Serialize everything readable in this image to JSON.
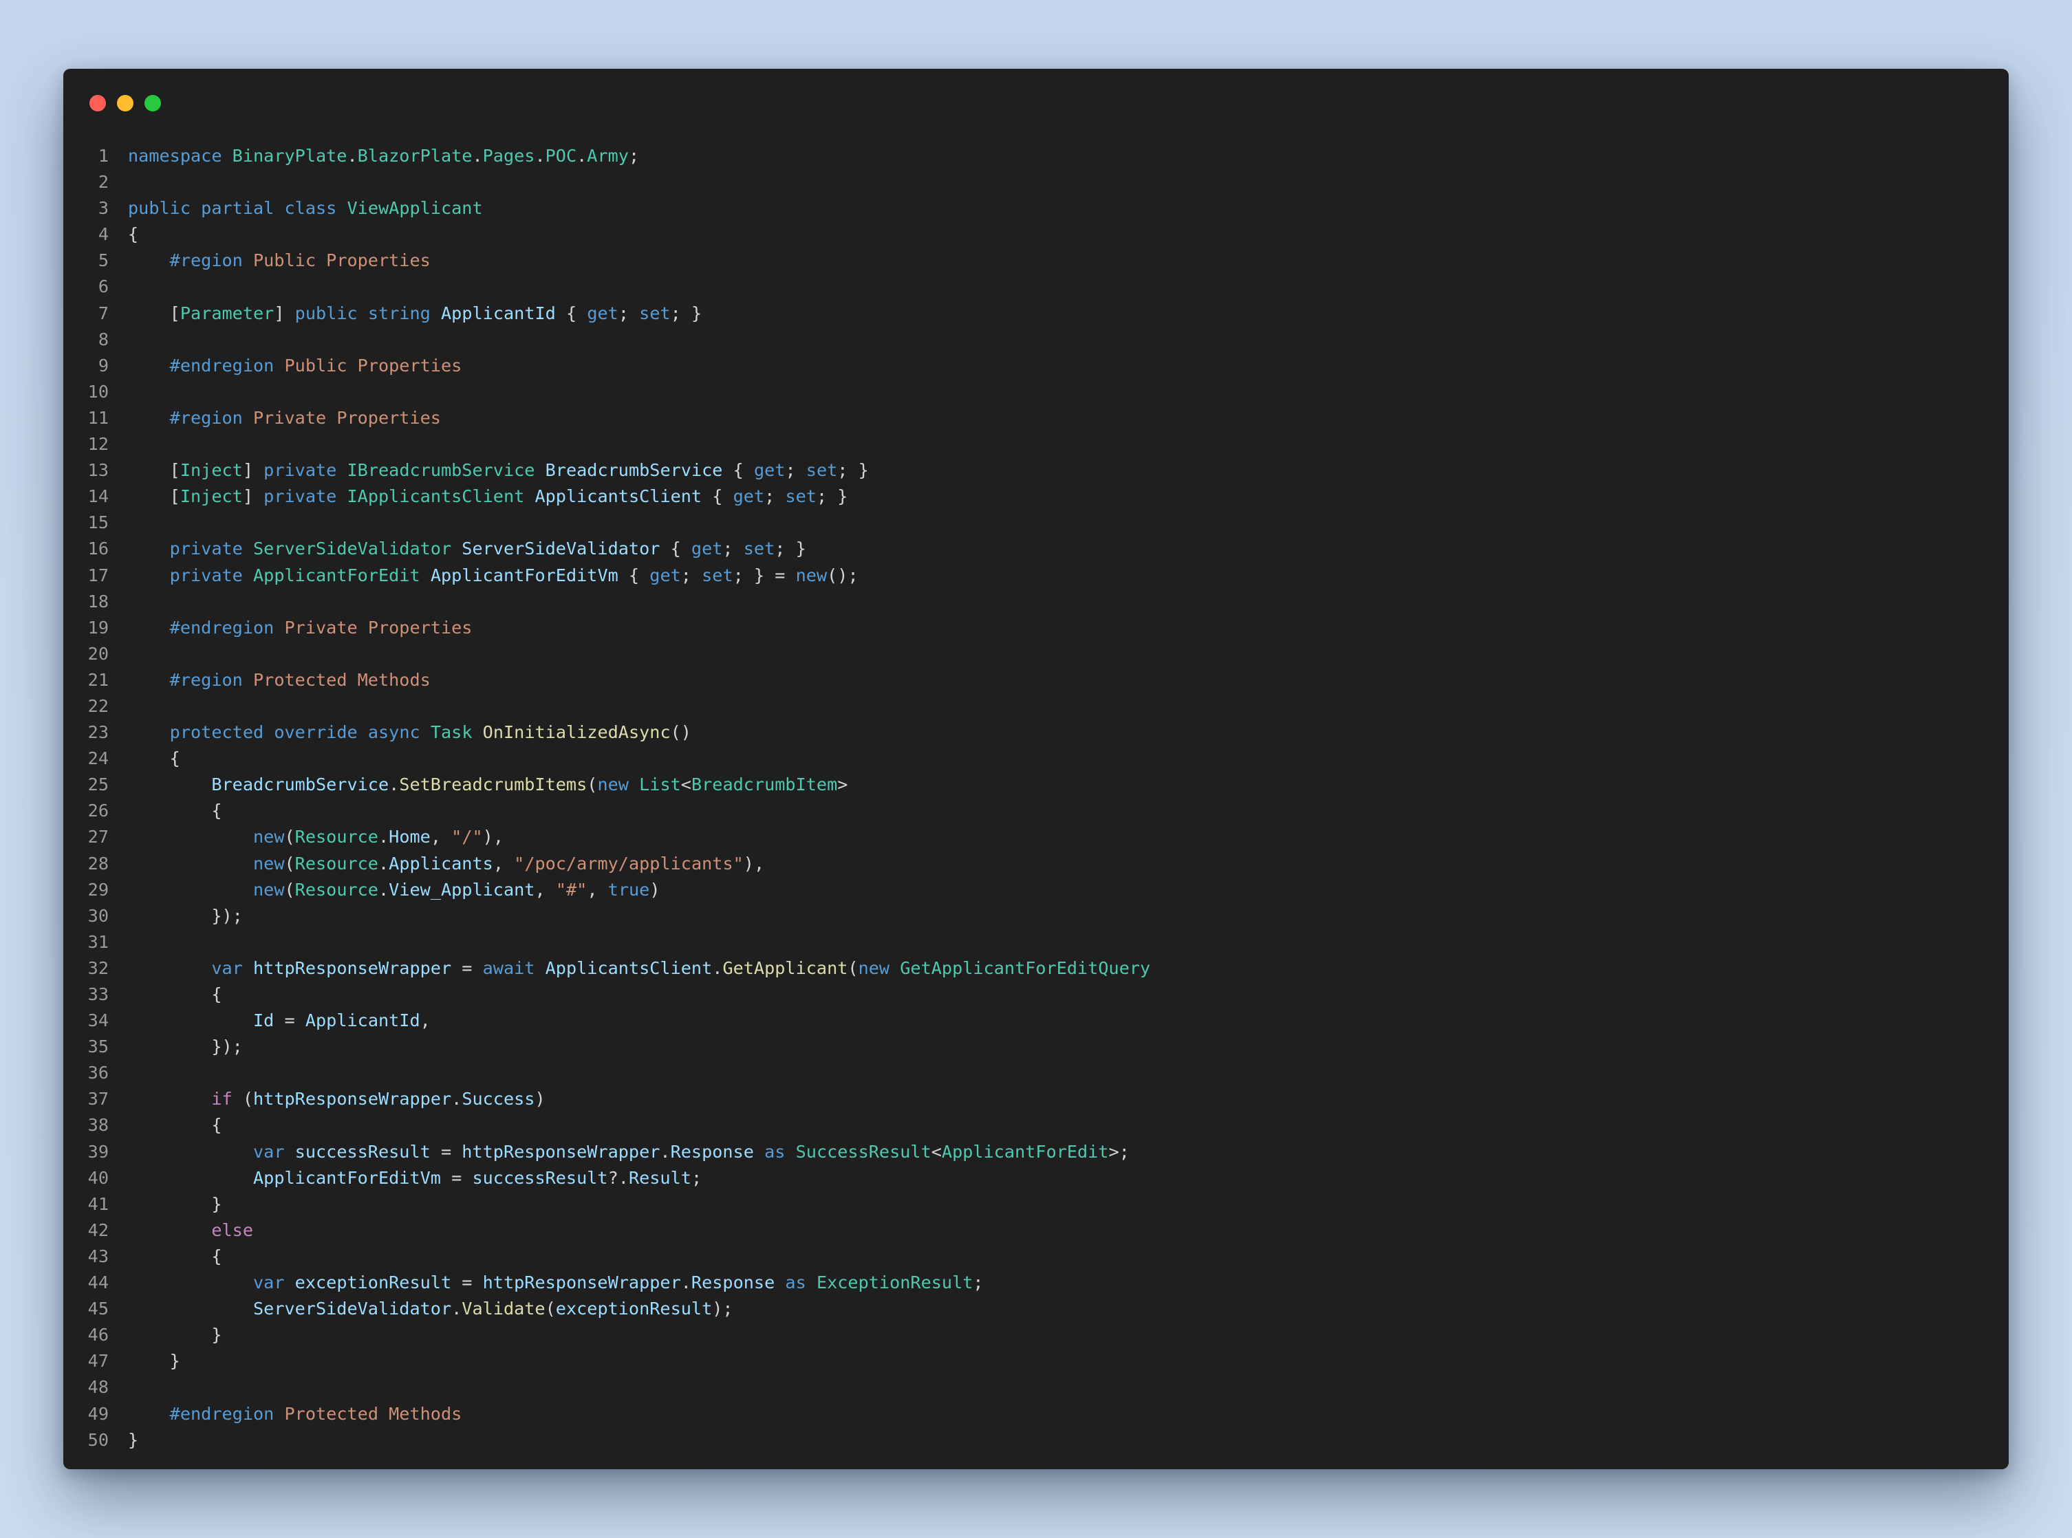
{
  "window": {
    "controls": [
      "close",
      "minimize",
      "maximize"
    ],
    "colors": {
      "close": "#ff5f57",
      "minimize": "#febc2e",
      "maximize": "#28c840",
      "background": "#1f1f1f"
    }
  },
  "editor": {
    "language": "csharp",
    "lines": [
      [
        [
          "kw",
          "namespace"
        ],
        [
          "p",
          " "
        ],
        [
          "type",
          "BinaryPlate"
        ],
        [
          "p",
          "."
        ],
        [
          "type",
          "BlazorPlate"
        ],
        [
          "p",
          "."
        ],
        [
          "type",
          "Pages"
        ],
        [
          "p",
          "."
        ],
        [
          "type",
          "POC"
        ],
        [
          "p",
          "."
        ],
        [
          "type",
          "Army"
        ],
        [
          "p",
          ";"
        ]
      ],
      [],
      [
        [
          "kw",
          "public"
        ],
        [
          "p",
          " "
        ],
        [
          "kw",
          "partial"
        ],
        [
          "p",
          " "
        ],
        [
          "kw",
          "class"
        ],
        [
          "p",
          " "
        ],
        [
          "type",
          "ViewApplicant"
        ]
      ],
      [
        [
          "p",
          "{"
        ]
      ],
      [
        [
          "p",
          "    "
        ],
        [
          "kw",
          "#region"
        ],
        [
          "p",
          " "
        ],
        [
          "reg",
          "Public Properties"
        ]
      ],
      [],
      [
        [
          "p",
          "    ["
        ],
        [
          "type",
          "Parameter"
        ],
        [
          "p",
          "] "
        ],
        [
          "kw",
          "public"
        ],
        [
          "p",
          " "
        ],
        [
          "kw",
          "string"
        ],
        [
          "p",
          " "
        ],
        [
          "id",
          "ApplicantId"
        ],
        [
          "p",
          " { "
        ],
        [
          "kw",
          "get"
        ],
        [
          "p",
          "; "
        ],
        [
          "kw",
          "set"
        ],
        [
          "p",
          "; }"
        ]
      ],
      [],
      [
        [
          "p",
          "    "
        ],
        [
          "kw",
          "#endregion"
        ],
        [
          "p",
          " "
        ],
        [
          "reg",
          "Public Properties"
        ]
      ],
      [],
      [
        [
          "p",
          "    "
        ],
        [
          "kw",
          "#region"
        ],
        [
          "p",
          " "
        ],
        [
          "reg",
          "Private Properties"
        ]
      ],
      [],
      [
        [
          "p",
          "    ["
        ],
        [
          "type",
          "Inject"
        ],
        [
          "p",
          "] "
        ],
        [
          "kw",
          "private"
        ],
        [
          "p",
          " "
        ],
        [
          "type",
          "IBreadcrumbService"
        ],
        [
          "p",
          " "
        ],
        [
          "id",
          "BreadcrumbService"
        ],
        [
          "p",
          " { "
        ],
        [
          "kw",
          "get"
        ],
        [
          "p",
          "; "
        ],
        [
          "kw",
          "set"
        ],
        [
          "p",
          "; }"
        ]
      ],
      [
        [
          "p",
          "    ["
        ],
        [
          "type",
          "Inject"
        ],
        [
          "p",
          "] "
        ],
        [
          "kw",
          "private"
        ],
        [
          "p",
          " "
        ],
        [
          "type",
          "IApplicantsClient"
        ],
        [
          "p",
          " "
        ],
        [
          "id",
          "ApplicantsClient"
        ],
        [
          "p",
          " { "
        ],
        [
          "kw",
          "get"
        ],
        [
          "p",
          "; "
        ],
        [
          "kw",
          "set"
        ],
        [
          "p",
          "; }"
        ]
      ],
      [],
      [
        [
          "p",
          "    "
        ],
        [
          "kw",
          "private"
        ],
        [
          "p",
          " "
        ],
        [
          "type",
          "ServerSideValidator"
        ],
        [
          "p",
          " "
        ],
        [
          "id",
          "ServerSideValidator"
        ],
        [
          "p",
          " { "
        ],
        [
          "kw",
          "get"
        ],
        [
          "p",
          "; "
        ],
        [
          "kw",
          "set"
        ],
        [
          "p",
          "; }"
        ]
      ],
      [
        [
          "p",
          "    "
        ],
        [
          "kw",
          "private"
        ],
        [
          "p",
          " "
        ],
        [
          "type",
          "ApplicantForEdit"
        ],
        [
          "p",
          " "
        ],
        [
          "id",
          "ApplicantForEditVm"
        ],
        [
          "p",
          " { "
        ],
        [
          "kw",
          "get"
        ],
        [
          "p",
          "; "
        ],
        [
          "kw",
          "set"
        ],
        [
          "p",
          "; } = "
        ],
        [
          "kw",
          "new"
        ],
        [
          "p",
          "();"
        ]
      ],
      [],
      [
        [
          "p",
          "    "
        ],
        [
          "kw",
          "#endregion"
        ],
        [
          "p",
          " "
        ],
        [
          "reg",
          "Private Properties"
        ]
      ],
      [],
      [
        [
          "p",
          "    "
        ],
        [
          "kw",
          "#region"
        ],
        [
          "p",
          " "
        ],
        [
          "reg",
          "Protected Methods"
        ]
      ],
      [],
      [
        [
          "p",
          "    "
        ],
        [
          "kw",
          "protected"
        ],
        [
          "p",
          " "
        ],
        [
          "kw",
          "override"
        ],
        [
          "p",
          " "
        ],
        [
          "kw",
          "async"
        ],
        [
          "p",
          " "
        ],
        [
          "type",
          "Task"
        ],
        [
          "p",
          " "
        ],
        [
          "fn",
          "OnInitializedAsync"
        ],
        [
          "p",
          "()"
        ]
      ],
      [
        [
          "p",
          "    {"
        ]
      ],
      [
        [
          "p",
          "        "
        ],
        [
          "id",
          "BreadcrumbService"
        ],
        [
          "p",
          "."
        ],
        [
          "fn",
          "SetBreadcrumbItems"
        ],
        [
          "p",
          "("
        ],
        [
          "kw",
          "new"
        ],
        [
          "p",
          " "
        ],
        [
          "type",
          "List"
        ],
        [
          "p",
          "<"
        ],
        [
          "type",
          "BreadcrumbItem"
        ],
        [
          "p",
          ">"
        ]
      ],
      [
        [
          "p",
          "        {"
        ]
      ],
      [
        [
          "p",
          "            "
        ],
        [
          "kw",
          "new"
        ],
        [
          "p",
          "("
        ],
        [
          "type",
          "Resource"
        ],
        [
          "p",
          "."
        ],
        [
          "id",
          "Home"
        ],
        [
          "p",
          ", "
        ],
        [
          "str",
          "\"/\""
        ],
        [
          "p",
          "),"
        ]
      ],
      [
        [
          "p",
          "            "
        ],
        [
          "kw",
          "new"
        ],
        [
          "p",
          "("
        ],
        [
          "type",
          "Resource"
        ],
        [
          "p",
          "."
        ],
        [
          "id",
          "Applicants"
        ],
        [
          "p",
          ", "
        ],
        [
          "str",
          "\"/poc/army/applicants\""
        ],
        [
          "p",
          "),"
        ]
      ],
      [
        [
          "p",
          "            "
        ],
        [
          "kw",
          "new"
        ],
        [
          "p",
          "("
        ],
        [
          "type",
          "Resource"
        ],
        [
          "p",
          "."
        ],
        [
          "id",
          "View_Applicant"
        ],
        [
          "p",
          ", "
        ],
        [
          "str",
          "\"#\""
        ],
        [
          "p",
          ", "
        ],
        [
          "kw",
          "true"
        ],
        [
          "p",
          ")"
        ]
      ],
      [
        [
          "p",
          "        });"
        ]
      ],
      [],
      [
        [
          "p",
          "        "
        ],
        [
          "kw",
          "var"
        ],
        [
          "p",
          " "
        ],
        [
          "id",
          "httpResponseWrapper"
        ],
        [
          "p",
          " = "
        ],
        [
          "kw",
          "await"
        ],
        [
          "p",
          " "
        ],
        [
          "id",
          "ApplicantsClient"
        ],
        [
          "p",
          "."
        ],
        [
          "fn",
          "GetApplicant"
        ],
        [
          "p",
          "("
        ],
        [
          "kw",
          "new"
        ],
        [
          "p",
          " "
        ],
        [
          "type",
          "GetApplicantForEditQuery"
        ]
      ],
      [
        [
          "p",
          "        {"
        ]
      ],
      [
        [
          "p",
          "            "
        ],
        [
          "id",
          "Id"
        ],
        [
          "p",
          " = "
        ],
        [
          "id",
          "ApplicantId"
        ],
        [
          "p",
          ","
        ]
      ],
      [
        [
          "p",
          "        });"
        ]
      ],
      [],
      [
        [
          "p",
          "        "
        ],
        [
          "ctrl",
          "if"
        ],
        [
          "p",
          " ("
        ],
        [
          "id",
          "httpResponseWrapper"
        ],
        [
          "p",
          "."
        ],
        [
          "id",
          "Success"
        ],
        [
          "p",
          ")"
        ]
      ],
      [
        [
          "p",
          "        {"
        ]
      ],
      [
        [
          "p",
          "            "
        ],
        [
          "kw",
          "var"
        ],
        [
          "p",
          " "
        ],
        [
          "id",
          "successResult"
        ],
        [
          "p",
          " = "
        ],
        [
          "id",
          "httpResponseWrapper"
        ],
        [
          "p",
          "."
        ],
        [
          "id",
          "Response"
        ],
        [
          "p",
          " "
        ],
        [
          "kw",
          "as"
        ],
        [
          "p",
          " "
        ],
        [
          "type",
          "SuccessResult"
        ],
        [
          "p",
          "<"
        ],
        [
          "type",
          "ApplicantForEdit"
        ],
        [
          "p",
          ">;"
        ]
      ],
      [
        [
          "p",
          "            "
        ],
        [
          "id",
          "ApplicantForEditVm"
        ],
        [
          "p",
          " = "
        ],
        [
          "id",
          "successResult"
        ],
        [
          "p",
          "?."
        ],
        [
          "id",
          "Result"
        ],
        [
          "p",
          ";"
        ]
      ],
      [
        [
          "p",
          "        }"
        ]
      ],
      [
        [
          "p",
          "        "
        ],
        [
          "ctrl",
          "else"
        ]
      ],
      [
        [
          "p",
          "        {"
        ]
      ],
      [
        [
          "p",
          "            "
        ],
        [
          "kw",
          "var"
        ],
        [
          "p",
          " "
        ],
        [
          "id",
          "exceptionResult"
        ],
        [
          "p",
          " = "
        ],
        [
          "id",
          "httpResponseWrapper"
        ],
        [
          "p",
          "."
        ],
        [
          "id",
          "Response"
        ],
        [
          "p",
          " "
        ],
        [
          "kw",
          "as"
        ],
        [
          "p",
          " "
        ],
        [
          "type",
          "ExceptionResult"
        ],
        [
          "p",
          ";"
        ]
      ],
      [
        [
          "p",
          "            "
        ],
        [
          "id",
          "ServerSideValidator"
        ],
        [
          "p",
          "."
        ],
        [
          "fn",
          "Validate"
        ],
        [
          "p",
          "("
        ],
        [
          "id",
          "exceptionResult"
        ],
        [
          "p",
          ");"
        ]
      ],
      [
        [
          "p",
          "        }"
        ]
      ],
      [
        [
          "p",
          "    }"
        ]
      ],
      [],
      [
        [
          "p",
          "    "
        ],
        [
          "kw",
          "#endregion"
        ],
        [
          "p",
          " "
        ],
        [
          "reg",
          "Protected Methods"
        ]
      ],
      [
        [
          "p",
          "}"
        ]
      ]
    ]
  }
}
